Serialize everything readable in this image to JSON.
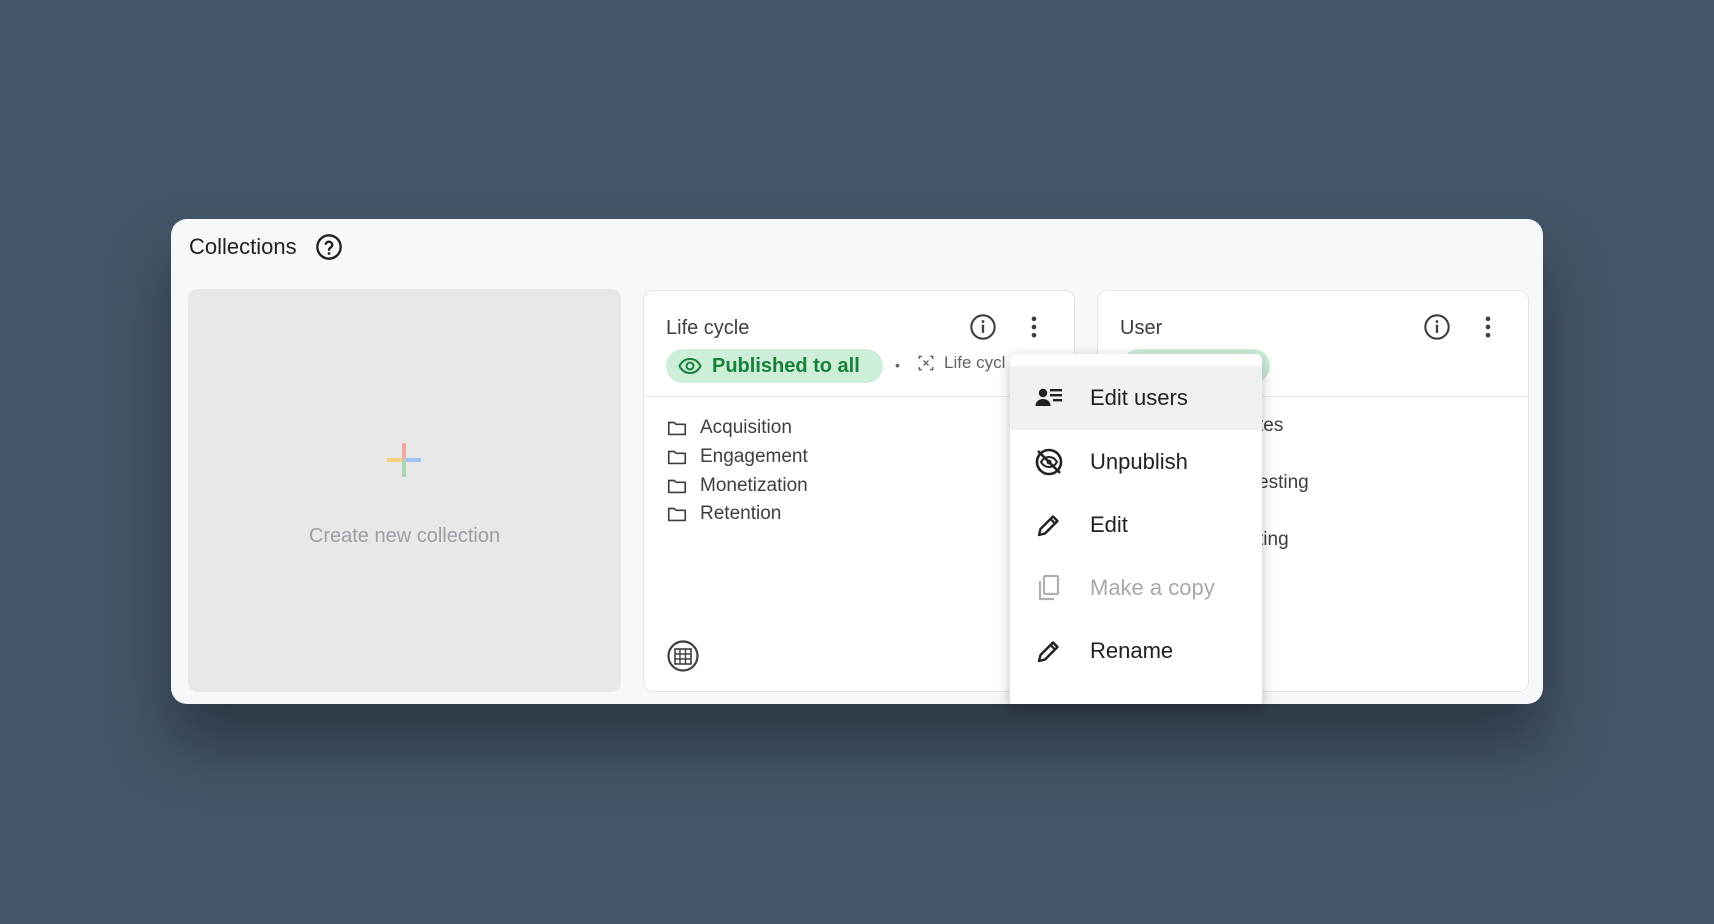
{
  "header": {
    "title": "Collections"
  },
  "create_card": {
    "label": "Create new collection"
  },
  "lifecycle_card": {
    "title": "Life cycle",
    "badge": "Published to all",
    "separator": "•",
    "collection_chip": "Life cycl",
    "folders": [
      "Acquisition",
      "Engagement",
      "Monetization",
      "Retention"
    ]
  },
  "user_card": {
    "title": "User",
    "fragments": [
      "tes",
      "esting",
      "ting"
    ]
  },
  "menu": {
    "items": [
      {
        "label": "Edit users",
        "icon": "edit-users-icon",
        "state": "hover"
      },
      {
        "label": "Unpublish",
        "icon": "unpublish-icon",
        "state": "normal"
      },
      {
        "label": "Edit",
        "icon": "pencil-icon",
        "state": "normal"
      },
      {
        "label": "Make a copy",
        "icon": "copy-icon",
        "state": "disabled"
      },
      {
        "label": "Rename",
        "icon": "pencil-icon",
        "state": "normal"
      }
    ]
  },
  "colors": {
    "background": "#445567",
    "panel": "#f7f8fa",
    "badge_bg": "#cdeed9",
    "badge_text": "#188038"
  }
}
